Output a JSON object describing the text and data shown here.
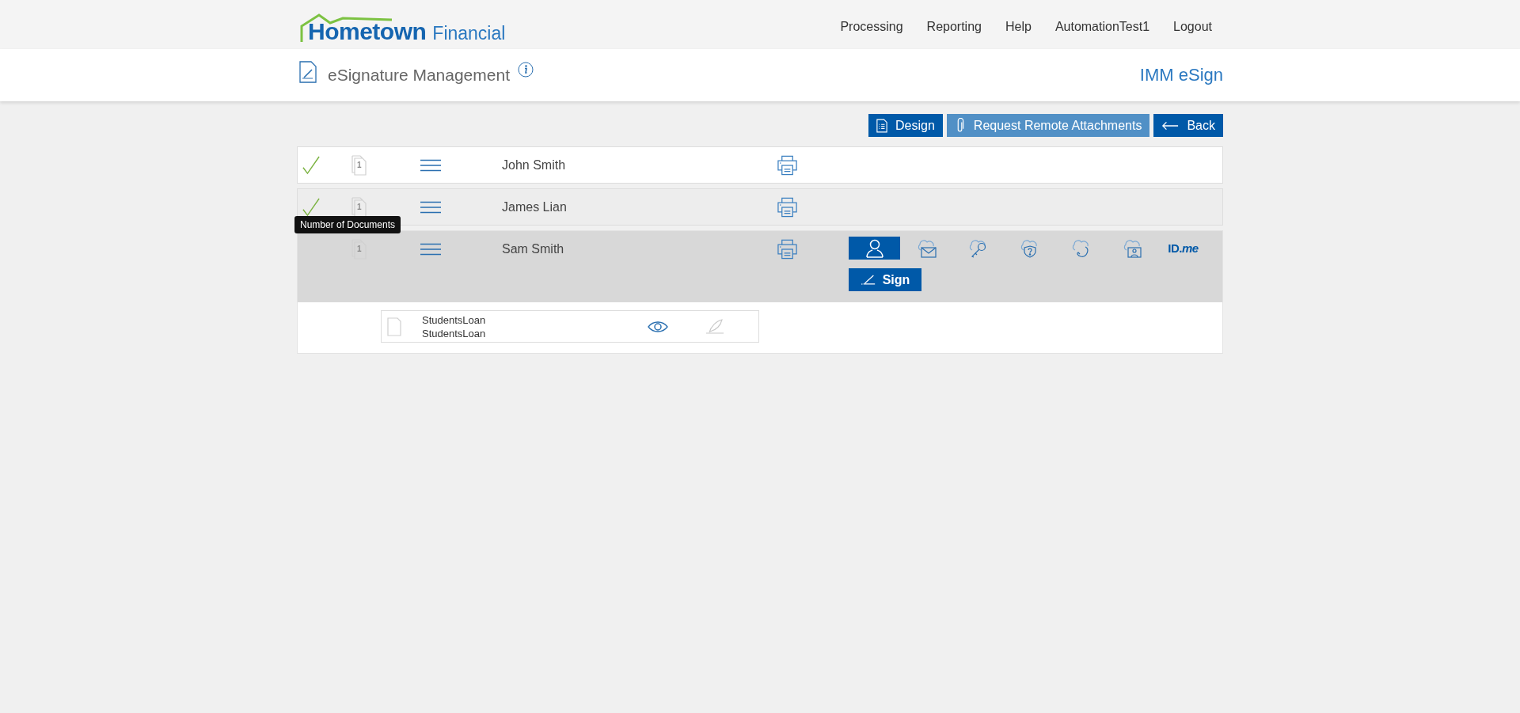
{
  "header": {
    "logo": {
      "word1": "Hometown",
      "word2": "Financial"
    },
    "nav": [
      {
        "label": "Processing"
      },
      {
        "label": "Reporting"
      },
      {
        "label": "Help"
      },
      {
        "label": "AutomationTest1"
      },
      {
        "label": "Logout"
      }
    ]
  },
  "title_bar": {
    "title": "eSignature Management",
    "app_name": "IMM eSign"
  },
  "toolbar": [
    {
      "kind": "design",
      "label": "Design",
      "disabled": false
    },
    {
      "kind": "attach",
      "label": "Request Remote Attachments",
      "disabled": true
    },
    {
      "kind": "back",
      "label": "Back",
      "disabled": false
    }
  ],
  "signers": [
    {
      "name": "John Smith",
      "signed": true,
      "doc_count": "1",
      "highlighted": false,
      "expanded": false
    },
    {
      "name": "James Lian",
      "signed": true,
      "doc_count": "1",
      "highlighted": true,
      "expanded": false
    },
    {
      "name": "Sam Smith",
      "signed": false,
      "doc_count": "1",
      "highlighted": false,
      "expanded": true,
      "tooltip": "Number of Documents",
      "auth_methods": [
        {
          "kind": "person",
          "selected": true
        },
        {
          "kind": "cloud-mail",
          "selected": false
        },
        {
          "kind": "cloud-key",
          "selected": false
        },
        {
          "kind": "cloud-question",
          "selected": false
        },
        {
          "kind": "cloud-phone",
          "selected": false
        },
        {
          "kind": "cloud-id",
          "selected": false
        },
        {
          "kind": "idme",
          "label": "ID.*me*",
          "selected": false
        }
      ],
      "sign_button": "Sign",
      "documents": [
        {
          "title": "StudentsLoan",
          "subtitle": "StudentsLoan",
          "signable": false
        }
      ]
    }
  ]
}
